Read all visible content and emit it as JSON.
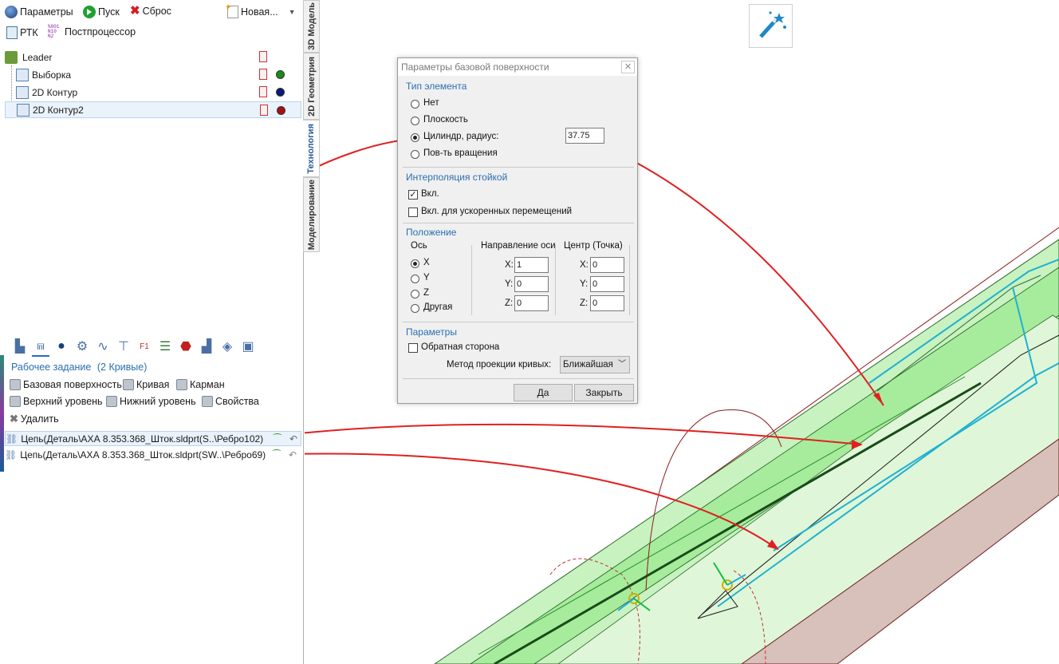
{
  "toolbar": {
    "params_label": "Параметры",
    "run_label": "Пуск",
    "reset_label": "Сброс",
    "new_label": "Новая...",
    "rtk_label": "РТК",
    "postproc_label": "Постпроцессор"
  },
  "tree": {
    "root": "Leader",
    "items": [
      {
        "label": "Выборка",
        "color": "#1a8a1a"
      },
      {
        "label": "2D Контур",
        "color": "#0a1a7a"
      },
      {
        "label": "2D Контур2",
        "color": "#a81010"
      }
    ]
  },
  "vtabs": [
    "3D Модель",
    "2D Геометрия",
    "Технология",
    "Моделирование"
  ],
  "task": {
    "title": "Рабочее задание",
    "count": "(2 Кривые)",
    "commands": {
      "base_surface": "Базовая поверхность",
      "curve": "Кривая",
      "pocket": "Карман",
      "upper_level": "Верхний уровень",
      "lower_level": "Нижний уровень",
      "properties": "Свойства",
      "delete": "Удалить"
    },
    "chains": [
      "Цепь(Деталь\\АХА 8.353.368_Шток.sldprt(S..\\Ребро102)",
      "Цепь(Деталь\\АХА 8.353.368_Шток.sldprt(SW..\\Ребро69)"
    ]
  },
  "dialog": {
    "title": "Параметры базовой поверхности",
    "element_type_title": "Тип элемента",
    "opt_none": "Нет",
    "opt_plane": "Плоскость",
    "opt_cylinder": "Цилиндр, радиус:",
    "opt_revolution": "Пов-ть вращения",
    "radius_value": "37.75",
    "interp_title": "Интерполяция стойкой",
    "interp_on": "Вкл.",
    "interp_rapid": "Вкл. для ускоренных перемещений",
    "position_title": "Положение",
    "axis_title": "Ось",
    "axis_x": "X",
    "axis_y": "Y",
    "axis_z": "Z",
    "axis_other": "Другая",
    "direction_title": "Направление оси",
    "center_title": "Центр (Точка)",
    "x_label": "X:",
    "y_label": "Y:",
    "z_label": "Z:",
    "dir_x": "1",
    "dir_y": "0",
    "dir_z": "0",
    "ctr_x": "0",
    "ctr_y": "0",
    "ctr_z": "0",
    "params_title": "Параметры",
    "reverse_side": "Обратная сторона",
    "projection_label": "Метод проекции кривых:",
    "projection_value": "Ближайшая",
    "ok_label": "Да",
    "close_label": "Закрыть"
  },
  "colors": {
    "accent": "#2a6fb0",
    "model_green": "#b8f0b0",
    "arrow_red": "#e02020"
  }
}
